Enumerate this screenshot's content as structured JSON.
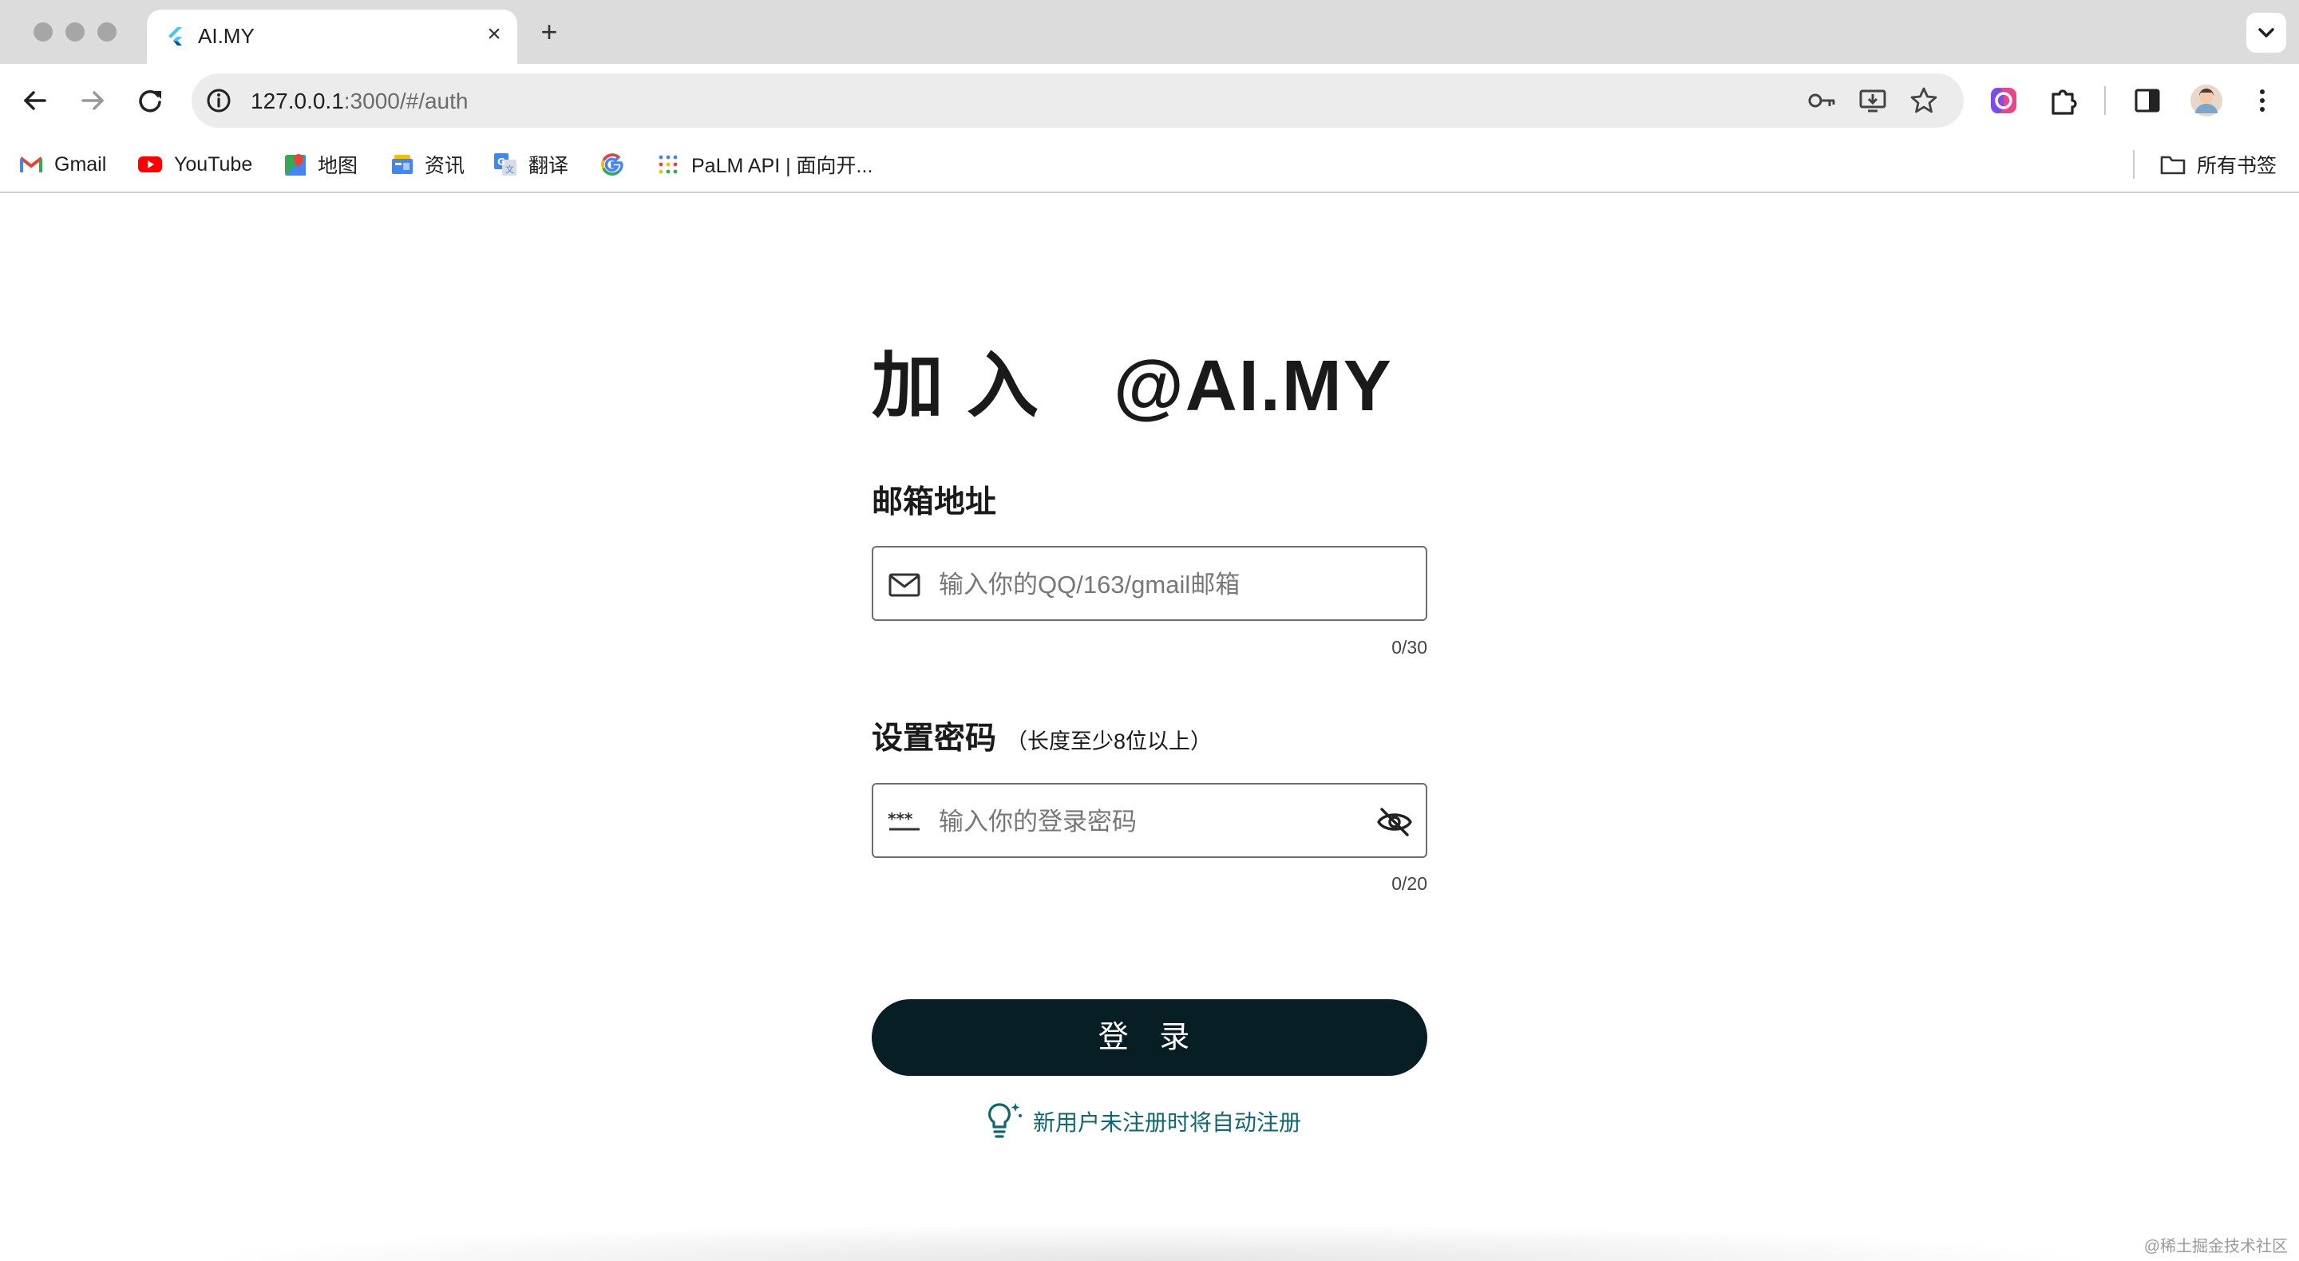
{
  "browser": {
    "tab": {
      "title": "AI.MY"
    },
    "url": {
      "host": "127.0.0.1",
      "path": ":3000/#/auth"
    },
    "bookmarks": [
      {
        "label": "Gmail",
        "icon": "gmail-icon"
      },
      {
        "label": "YouTube",
        "icon": "youtube-icon"
      },
      {
        "label": "地图",
        "icon": "maps-icon"
      },
      {
        "label": "资讯",
        "icon": "news-icon"
      },
      {
        "label": "翻译",
        "icon": "translate-icon"
      },
      {
        "label": "",
        "icon": "google-icon"
      },
      {
        "label": "PaLM API | 面向开...",
        "icon": "palm-icon"
      }
    ],
    "all_bookmarks": "所有书签"
  },
  "auth": {
    "headline": "加 入　@AI.MY",
    "email_label": "邮箱地址",
    "email_placeholder": "输入你的QQ/163/gmail邮箱",
    "email_counter": "0/30",
    "password_label": "设置密码",
    "password_hint": "（长度至少8位以上）",
    "password_placeholder": "输入你的登录密码",
    "password_counter": "0/20",
    "login_button": "登 录",
    "tip": "新用户未注册时将自动注册"
  },
  "watermark": "@稀土掘金技术社区",
  "colors": {
    "button": "#071f24",
    "tip": "#0f6771"
  }
}
